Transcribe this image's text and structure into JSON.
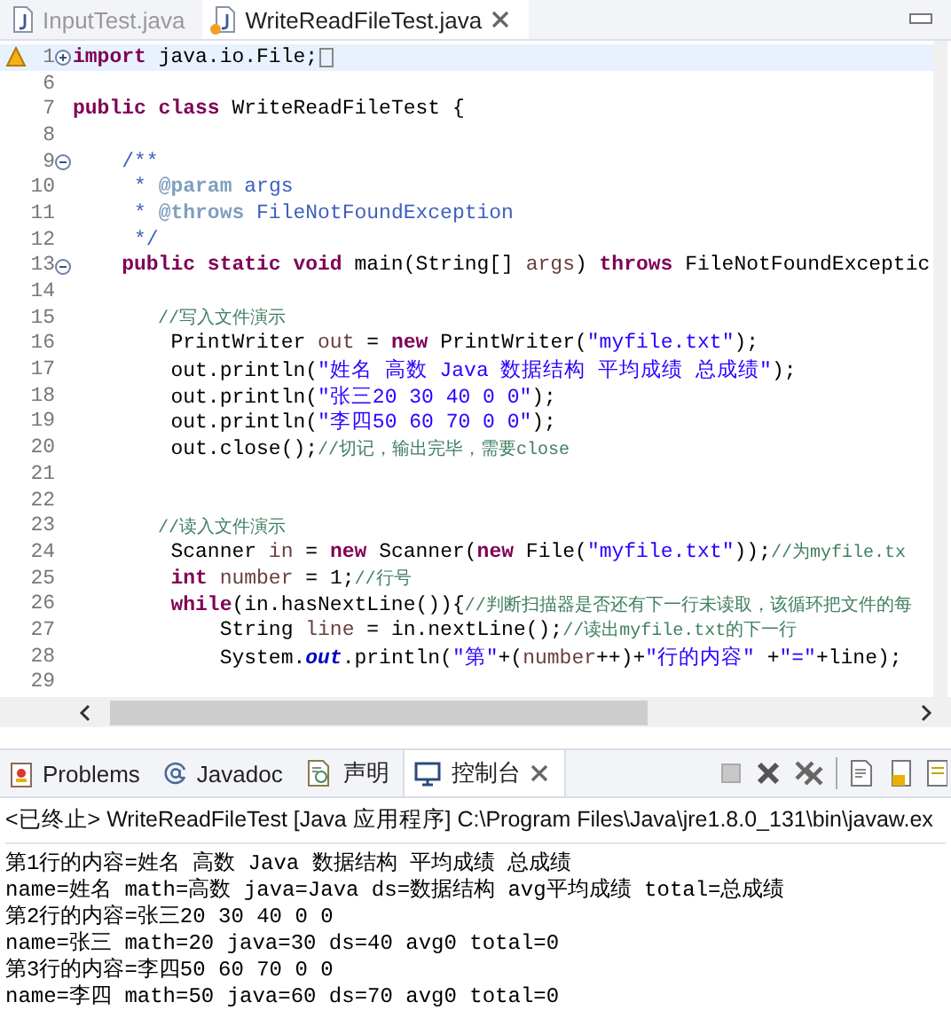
{
  "editor_tabs": [
    {
      "label": "InputTest.java",
      "selected": false,
      "warning": false
    },
    {
      "label": "WriteReadFileTest.java",
      "selected": true,
      "warning": true
    }
  ],
  "code_lines": [
    {
      "number": "1",
      "expanded": false,
      "current": true,
      "tokens": [
        {
          "kind": "kw",
          "text": "import"
        },
        {
          "kind": "plain",
          "text": " java.io.File;"
        }
      ]
    },
    {
      "number": "6"
    },
    {
      "number": "7",
      "tokens": [
        {
          "kind": "kw",
          "text": "public class"
        },
        {
          "kind": "plain",
          "text": " WriteReadFileTest {"
        }
      ]
    },
    {
      "number": "8"
    },
    {
      "number": "9",
      "expanded": true,
      "tokens": [
        {
          "kind": "doc",
          "text": "    /**"
        }
      ]
    },
    {
      "number": "10",
      "tokens": [
        {
          "kind": "doc",
          "text": "     * "
        },
        {
          "kind": "doctag",
          "text": "@param"
        },
        {
          "kind": "doc",
          "text": " args"
        }
      ]
    },
    {
      "number": "11",
      "tokens": [
        {
          "kind": "doc",
          "text": "     * "
        },
        {
          "kind": "doctag",
          "text": "@throws"
        },
        {
          "kind": "doc",
          "text": " FileNotFoundException"
        }
      ]
    },
    {
      "number": "12",
      "tokens": [
        {
          "kind": "doc",
          "text": "     */"
        }
      ]
    },
    {
      "number": "13",
      "expanded": true,
      "tokens": [
        {
          "kind": "kw",
          "text": "    public static void"
        },
        {
          "kind": "plain",
          "text": " main(String[] "
        },
        {
          "kind": "var",
          "text": "args"
        },
        {
          "kind": "plain",
          "text": ") "
        },
        {
          "kind": "kw",
          "text": "throws"
        },
        {
          "kind": "plain",
          "text": " FileNotFoundExceptic"
        }
      ]
    },
    {
      "number": "14"
    },
    {
      "number": "15",
      "tokens": [
        {
          "kind": "comment",
          "text": "        //写入文件演示"
        }
      ]
    },
    {
      "number": "16",
      "tokens": [
        {
          "kind": "plain",
          "text": "        PrintWriter "
        },
        {
          "kind": "var",
          "text": "out"
        },
        {
          "kind": "plain",
          "text": " = "
        },
        {
          "kind": "kw",
          "text": "new"
        },
        {
          "kind": "plain",
          "text": " PrintWriter("
        },
        {
          "kind": "str",
          "text": "\"myfile.txt\""
        },
        {
          "kind": "plain",
          "text": ");"
        }
      ]
    },
    {
      "number": "17",
      "tokens": [
        {
          "kind": "plain",
          "text": "        out.println("
        },
        {
          "kind": "str",
          "text": "\"姓名 高数 Java 数据结构 平均成绩 总成绩\""
        },
        {
          "kind": "plain",
          "text": ");"
        }
      ]
    },
    {
      "number": "18",
      "tokens": [
        {
          "kind": "plain",
          "text": "        out.println("
        },
        {
          "kind": "str",
          "text": "\"张三20 30 40 0 0\""
        },
        {
          "kind": "plain",
          "text": ");"
        }
      ]
    },
    {
      "number": "19",
      "tokens": [
        {
          "kind": "plain",
          "text": "        out.println("
        },
        {
          "kind": "str",
          "text": "\"李四50 60 70 0 0\""
        },
        {
          "kind": "plain",
          "text": ");"
        }
      ]
    },
    {
      "number": "20",
      "tokens": [
        {
          "kind": "plain",
          "text": "        out.close();"
        },
        {
          "kind": "comment",
          "text": "//切记，输出完毕，需要close"
        }
      ]
    },
    {
      "number": "21"
    },
    {
      "number": "22"
    },
    {
      "number": "23",
      "tokens": [
        {
          "kind": "comment",
          "text": "        //读入文件演示"
        }
      ]
    },
    {
      "number": "24",
      "tokens": [
        {
          "kind": "plain",
          "text": "        Scanner "
        },
        {
          "kind": "var",
          "text": "in"
        },
        {
          "kind": "plain",
          "text": " = "
        },
        {
          "kind": "kw",
          "text": "new"
        },
        {
          "kind": "plain",
          "text": " Scanner("
        },
        {
          "kind": "kw",
          "text": "new"
        },
        {
          "kind": "plain",
          "text": " File("
        },
        {
          "kind": "str",
          "text": "\"myfile.txt\""
        },
        {
          "kind": "plain",
          "text": "));"
        },
        {
          "kind": "comment",
          "text": "//为myfile.tx"
        }
      ]
    },
    {
      "number": "25",
      "tokens": [
        {
          "kind": "kw",
          "text": "        int"
        },
        {
          "kind": "var",
          "text": " number"
        },
        {
          "kind": "plain",
          "text": " = 1;"
        },
        {
          "kind": "comment",
          "text": "//行号"
        }
      ]
    },
    {
      "number": "26",
      "tokens": [
        {
          "kind": "kw",
          "text": "        while"
        },
        {
          "kind": "plain",
          "text": "(in.hasNextLine()){"
        },
        {
          "kind": "comment",
          "text": "//判断扫描器是否还有下一行未读取，该循环把文件的每"
        }
      ]
    },
    {
      "number": "27",
      "tokens": [
        {
          "kind": "plain",
          "text": "            String "
        },
        {
          "kind": "var",
          "text": "line"
        },
        {
          "kind": "plain",
          "text": " = in.nextLine();"
        },
        {
          "kind": "comment",
          "text": "//读出myfile.txt的下一行"
        }
      ]
    },
    {
      "number": "28",
      "tokens": [
        {
          "kind": "plain",
          "text": "            System."
        },
        {
          "kind": "field",
          "text": "out"
        },
        {
          "kind": "plain",
          "text": ".println("
        },
        {
          "kind": "str",
          "text": "\"第\""
        },
        {
          "kind": "plain",
          "text": "+("
        },
        {
          "kind": "var",
          "text": "number"
        },
        {
          "kind": "plain",
          "text": "++)+"
        },
        {
          "kind": "str",
          "text": "\"行的内容\""
        },
        {
          "kind": "plain",
          "text": " +"
        },
        {
          "kind": "str",
          "text": "\"=\""
        },
        {
          "kind": "plain",
          "text": "+line);"
        }
      ]
    },
    {
      "number": "29"
    }
  ],
  "console_tabs": [
    {
      "label": "Problems",
      "selected": false
    },
    {
      "label": "Javadoc",
      "selected": false
    },
    {
      "label": "声明",
      "selected": false
    },
    {
      "label": "控制台",
      "selected": true
    }
  ],
  "console_header": "<已终止> WriteReadFileTest [Java 应用程序] C:\\Program Files\\Java\\jre1.8.0_131\\bin\\javaw.ex",
  "console_output": [
    "第1行的内容=姓名 高数 Java 数据结构 平均成绩 总成绩",
    "name=姓名 math=高数 java=Java ds=数据结构 avg平均成绩 total=总成绩",
    "第2行的内容=张三20 30 40 0 0",
    "name=张三 math=20 java=30 ds=40 avg0 total=0",
    "第3行的内容=李四50 60 70 0 0",
    "name=李四 math=50 java=60 ds=70 avg0 total=0"
  ]
}
